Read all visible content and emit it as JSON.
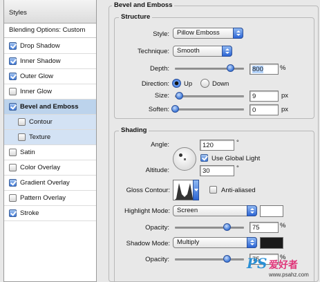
{
  "sidebar": {
    "header": "Styles",
    "blending_options": "Blending Options: Custom",
    "items": [
      {
        "label": "Drop Shadow",
        "checked": true
      },
      {
        "label": "Inner Shadow",
        "checked": true
      },
      {
        "label": "Outer Glow",
        "checked": true
      },
      {
        "label": "Inner Glow",
        "checked": false
      },
      {
        "label": "Bevel and Emboss",
        "checked": true,
        "selected": true
      },
      {
        "label": "Contour",
        "checked": false,
        "sub": true
      },
      {
        "label": "Texture",
        "checked": false,
        "sub": true
      },
      {
        "label": "Satin",
        "checked": false
      },
      {
        "label": "Color Overlay",
        "checked": false
      },
      {
        "label": "Gradient Overlay",
        "checked": true
      },
      {
        "label": "Pattern Overlay",
        "checked": false
      },
      {
        "label": "Stroke",
        "checked": true
      }
    ]
  },
  "bevel": {
    "title": "Bevel and Emboss",
    "structure": {
      "title": "Structure",
      "style_label": "Style:",
      "style_value": "Pillow Emboss",
      "technique_label": "Technique:",
      "technique_value": "Smooth",
      "depth_label": "Depth:",
      "depth_value": "800",
      "depth_unit": "%",
      "depth_level": 0.8,
      "direction_label": "Direction:",
      "direction_up": "Up",
      "direction_down": "Down",
      "direction_selected": "Up",
      "size_label": "Size:",
      "size_value": "9",
      "size_unit": "px",
      "size_level": 0.06,
      "soften_label": "Soften:",
      "soften_value": "0",
      "soften_unit": "px",
      "soften_level": 0.0
    },
    "shading": {
      "title": "Shading",
      "angle_label": "Angle:",
      "angle_value": "120",
      "angle_unit": "°",
      "global_light_label": "Use Global Light",
      "global_light_checked": true,
      "altitude_label": "Altitude:",
      "altitude_value": "30",
      "altitude_unit": "°",
      "gloss_label": "Gloss Contour:",
      "anti_aliased_label": "Anti-aliased",
      "anti_aliased_checked": false,
      "highlight_mode_label": "Highlight Mode:",
      "highlight_mode_value": "Screen",
      "highlight_color": "#ffffff",
      "highlight_opacity_label": "Opacity:",
      "highlight_opacity_value": "75",
      "highlight_opacity_unit": "%",
      "highlight_opacity_level": 0.75,
      "shadow_mode_label": "Shadow Mode:",
      "shadow_mode_value": "Multiply",
      "shadow_color": "#1a1a1a",
      "shadow_opacity_label": "Opacity:",
      "shadow_opacity_value": "75",
      "shadow_opacity_unit": "%",
      "shadow_opacity_level": 0.75
    }
  },
  "watermark": {
    "brand": "PS",
    "cn": "爱好者",
    "url": "www.psahz.com"
  },
  "colors": {
    "accent": "#3f79d8",
    "selected_row": "#bcd3ec",
    "sub_row": "#d3e2f4"
  }
}
